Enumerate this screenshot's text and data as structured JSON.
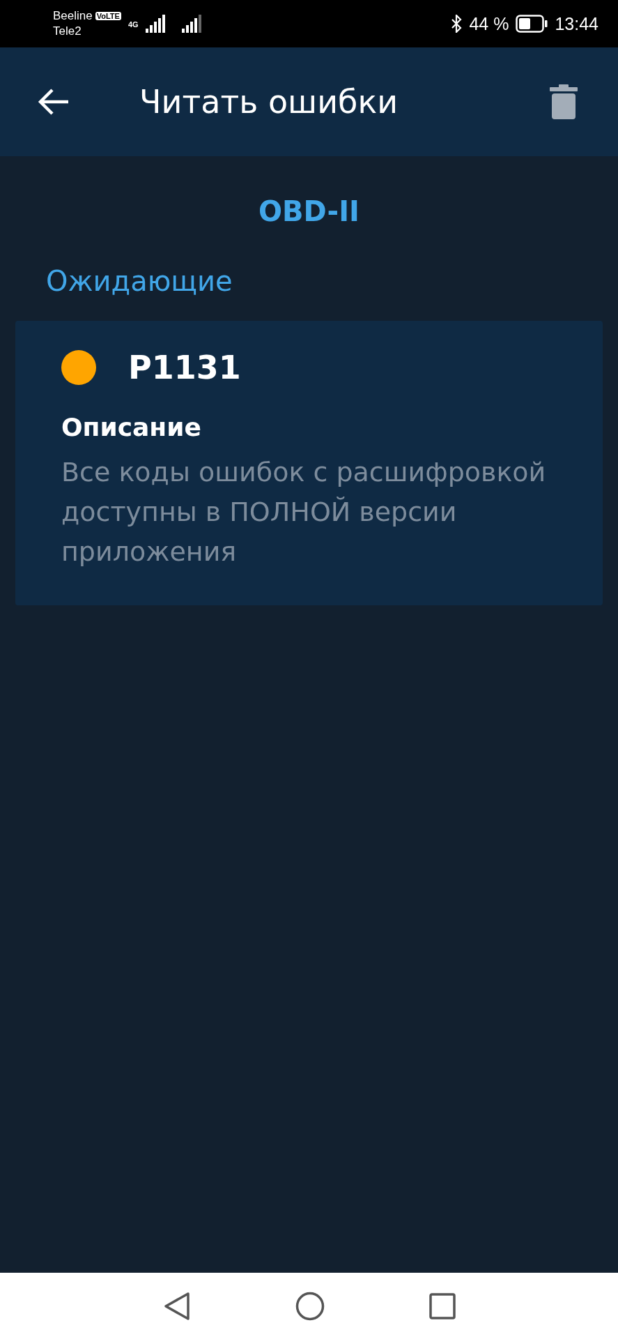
{
  "status_bar": {
    "carrier_1": "Beeline",
    "volte": "VoLTE",
    "network": "4G",
    "carrier_2": "Tele2",
    "battery": "44 %",
    "time": "13:44"
  },
  "app_bar": {
    "title": "Читать ошибки"
  },
  "protocol": "OBD-II",
  "section": "Ожидающие",
  "errors": [
    {
      "code": "P1131",
      "color": "#ffa500",
      "heading": "Описание",
      "text": "Все коды ошибок с расшифровкой доступны в ПОЛНОЙ версии приложения"
    }
  ]
}
